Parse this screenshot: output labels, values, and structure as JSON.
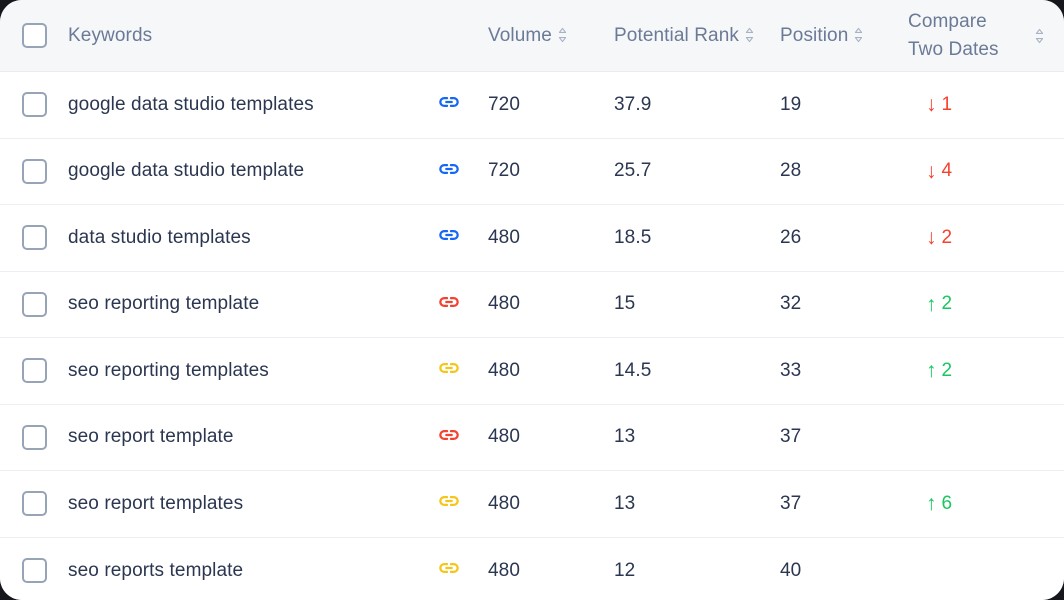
{
  "table": {
    "columns": [
      {
        "id": "select",
        "label": "",
        "sortable": false
      },
      {
        "id": "keyword",
        "label": "Keywords",
        "sortable": false
      },
      {
        "id": "link",
        "label": "",
        "sortable": false
      },
      {
        "id": "volume",
        "label": "Volume",
        "sortable": true
      },
      {
        "id": "rank",
        "label": "Potential Rank",
        "sortable": true
      },
      {
        "id": "position",
        "label": "Position",
        "sortable": true
      },
      {
        "id": "compare",
        "label": "Compare\nTwo Dates",
        "sortable": true
      }
    ],
    "select_all_checkbox": {
      "checked": false
    },
    "rows": [
      {
        "keyword": "google data studio templates",
        "link_icon": "link-icon",
        "link_color": "#1567f5",
        "volume": "720",
        "potential_rank": "37.9",
        "position": "19",
        "change_direction": "down",
        "change_arrow": "↓",
        "change_value": "1"
      },
      {
        "keyword": "google data studio template",
        "link_icon": "link-icon",
        "link_color": "#1567f5",
        "volume": "720",
        "potential_rank": "25.7",
        "position": "28",
        "change_direction": "down",
        "change_arrow": "↓",
        "change_value": "4"
      },
      {
        "keyword": "data studio templates",
        "link_icon": "link-icon",
        "link_color": "#1567f5",
        "volume": "480",
        "potential_rank": "18.5",
        "position": "26",
        "change_direction": "down",
        "change_arrow": "↓",
        "change_value": "2"
      },
      {
        "keyword": "seo reporting template",
        "link_icon": "link-icon",
        "link_color": "#f5412f",
        "volume": "480",
        "potential_rank": "15",
        "position": "32",
        "change_direction": "up",
        "change_arrow": "↑",
        "change_value": "2"
      },
      {
        "keyword": "seo reporting templates",
        "link_icon": "link-icon",
        "link_color": "#f5c518",
        "volume": "480",
        "potential_rank": "14.5",
        "position": "33",
        "change_direction": "up",
        "change_arrow": "↑",
        "change_value": "2"
      },
      {
        "keyword": "seo report template",
        "link_icon": "link-icon",
        "link_color": "#f5412f",
        "volume": "480",
        "potential_rank": "13",
        "position": "37",
        "change_direction": "none",
        "change_arrow": "",
        "change_value": ""
      },
      {
        "keyword": "seo report templates",
        "link_icon": "link-icon",
        "link_color": "#f5c518",
        "volume": "480",
        "potential_rank": "13",
        "position": "37",
        "change_direction": "up",
        "change_arrow": "↑",
        "change_value": "6"
      },
      {
        "keyword": "seo reports template",
        "link_icon": "link-icon",
        "link_color": "#f5c518",
        "volume": "480",
        "potential_rank": "12",
        "position": "40",
        "change_direction": "none",
        "change_arrow": "",
        "change_value": ""
      }
    ]
  },
  "colors": {
    "header_bg": "#f6f7f9",
    "header_text": "#6b7a96",
    "row_bg": "#ffffff",
    "row_text": "#2b3650",
    "divider": "#eceef3",
    "checkbox_border": "#97a3b6",
    "increase": "#19c760",
    "decrease": "#f5412f",
    "link_blue": "#1567f5",
    "link_red": "#f5412f",
    "link_yellow": "#f5c518"
  }
}
